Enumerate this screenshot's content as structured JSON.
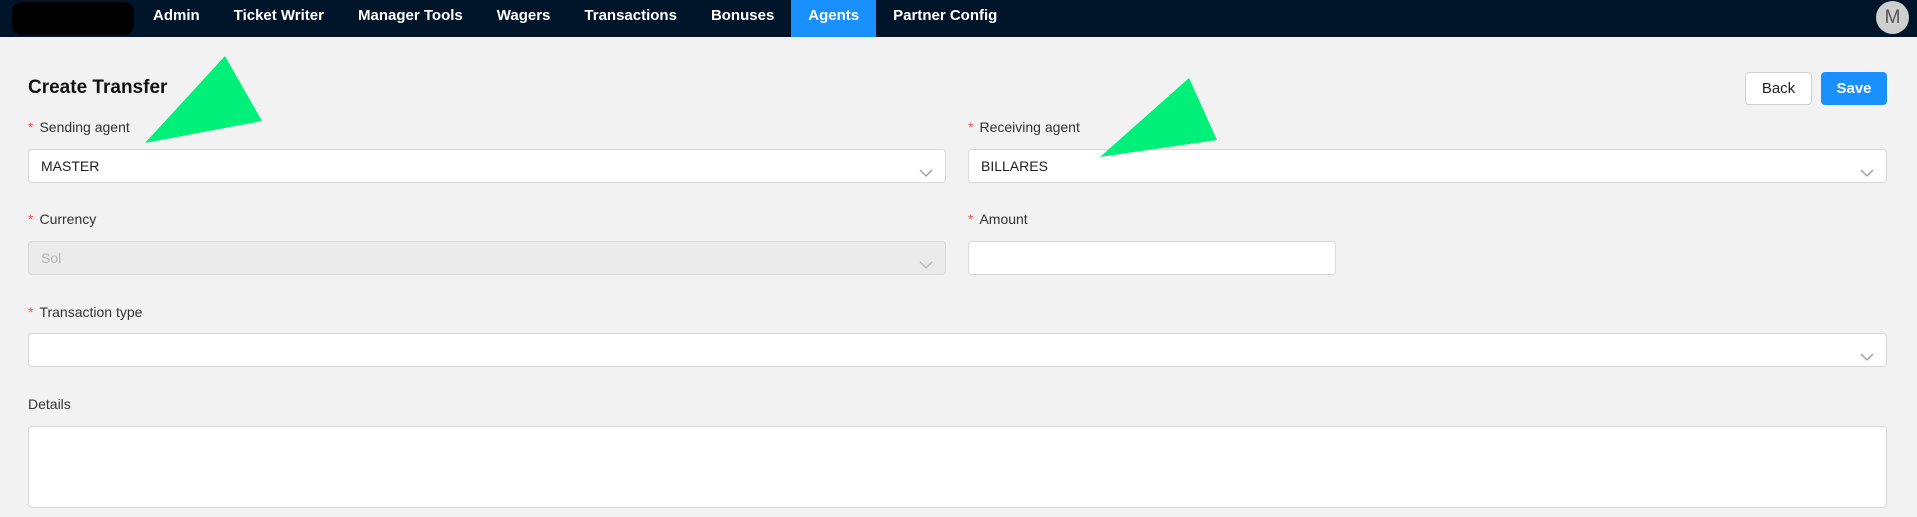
{
  "nav": {
    "items": [
      {
        "label": "Admin",
        "active": false
      },
      {
        "label": "Ticket Writer",
        "active": false
      },
      {
        "label": "Manager Tools",
        "active": false
      },
      {
        "label": "Wagers",
        "active": false
      },
      {
        "label": "Transactions",
        "active": false
      },
      {
        "label": "Bonuses",
        "active": false
      },
      {
        "label": "Agents",
        "active": true
      },
      {
        "label": "Partner Config",
        "active": false
      }
    ],
    "avatar_initial": "M"
  },
  "page": {
    "title": "Create Transfer",
    "back_label": "Back",
    "save_label": "Save"
  },
  "form": {
    "required_mark": "*",
    "sending_agent": {
      "label": "Sending agent",
      "value": "MASTER"
    },
    "receiving_agent": {
      "label": "Receiving agent",
      "value": "BILLARES"
    },
    "currency": {
      "label": "Currency",
      "value": "Sol",
      "disabled": true
    },
    "amount": {
      "label": "Amount",
      "value": ""
    },
    "transaction_type": {
      "label": "Transaction type",
      "value": ""
    },
    "details": {
      "label": "Details",
      "value": ""
    }
  },
  "colors": {
    "nav_bg": "#001529",
    "accent": "#1890ff",
    "required": "#ff4d4f",
    "annotation": "#00f07a"
  }
}
